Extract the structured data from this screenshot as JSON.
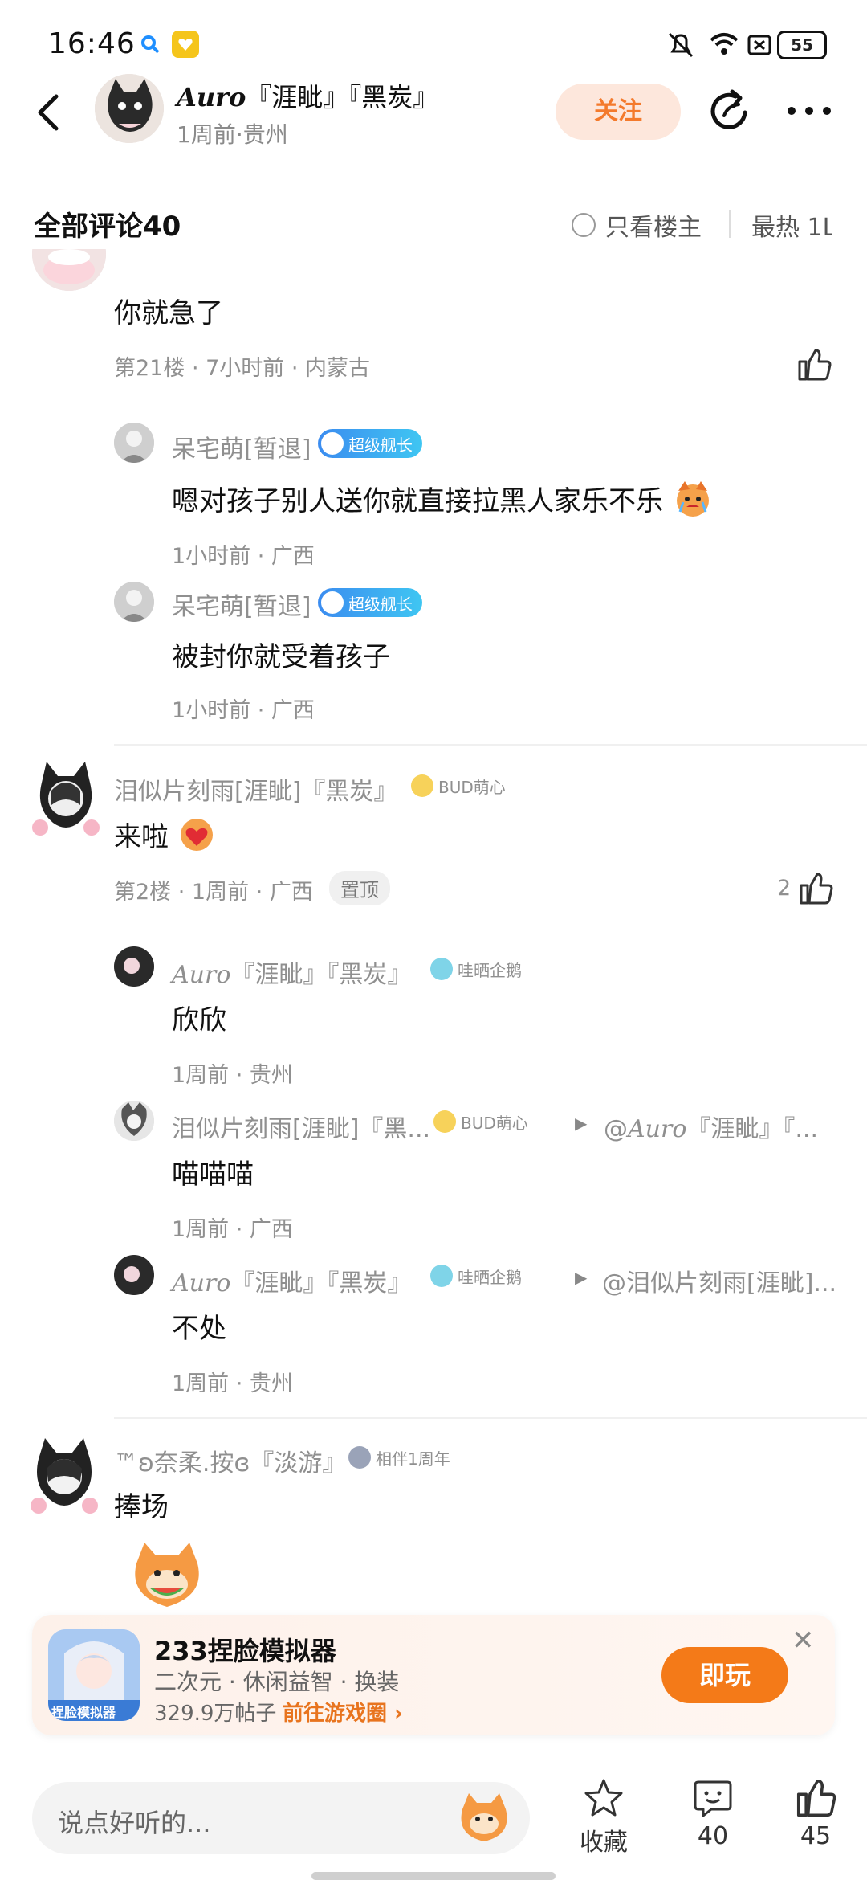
{
  "status_bar": {
    "time": "16:46",
    "battery": "55"
  },
  "header": {
    "name_italic": "Auro",
    "name_rest": "『涯眦』『黑炭』",
    "subtitle": "1周前·贵州",
    "follow_label": "关注"
  },
  "comments_header": {
    "title": "全部评论40",
    "only_host": "只看楼主",
    "sort": "最热 1L"
  },
  "comment1": {
    "text": "你就急了",
    "meta": "第21楼 · 7小时前 · 内蒙古",
    "replies": [
      {
        "name": "呆宅萌[暂退]",
        "badge": "超级舰长",
        "text": "嗯对孩子别人送你就直接拉黑人家乐不乐",
        "meta": "1小时前 · 广西"
      },
      {
        "name": "呆宅萌[暂退]",
        "badge": "超级舰长",
        "text": "被封你就受着孩子",
        "meta": "1小时前 · 广西"
      }
    ]
  },
  "comment2": {
    "name": "泪似片刻雨[涯眦]『黑炭』",
    "badge": "BUD萌心",
    "text": "来啦",
    "meta": "第2楼 · 1周前 · 广西",
    "pin": "置顶",
    "likes": "2",
    "replies": [
      {
        "name_italic": "Auro",
        "name_rest": "『涯眦』『黑炭』",
        "badge": "哇晒企鹅",
        "text": "欣欣",
        "meta": "1周前 · 贵州"
      },
      {
        "name": "泪似片刻雨[涯眦]『黑...",
        "badge": "BUD萌心",
        "at_italic": "Auro",
        "at": "『涯眦』『...",
        "text": "喵喵喵",
        "meta": "1周前 · 广西"
      },
      {
        "name_italic": "Auro",
        "name_rest": "『涯眦』『黑炭』",
        "badge": "哇晒企鹅",
        "at": "@泪似片刻雨[涯眦]...",
        "text": "不处",
        "meta": "1周前 · 贵州"
      }
    ]
  },
  "comment3": {
    "name": "™ʚ奈柔.按ɞ『淡游』",
    "badge": "相伴1周年",
    "text": "捧场"
  },
  "game_banner": {
    "title": "233捏脸模拟器",
    "subtitle": "二次元 · 休闲益智 · 换装",
    "posts": "329.9万帖子",
    "link": "前往游戏圈",
    "play": "即玩",
    "icon_text": "捏脸模拟器"
  },
  "bottom_bar": {
    "placeholder": "说点好听的...",
    "collect": "收藏",
    "comments": "40",
    "likes": "45"
  }
}
